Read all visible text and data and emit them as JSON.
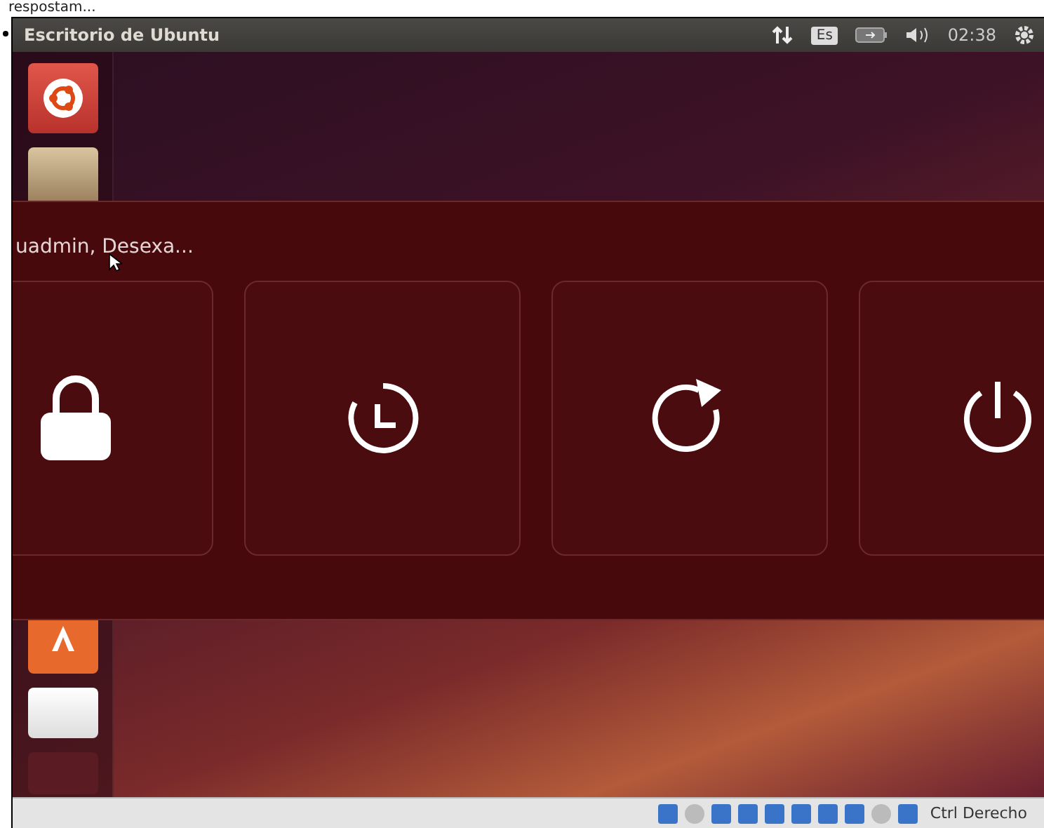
{
  "page": {
    "caption": "respostam..."
  },
  "top_panel": {
    "title": "Escritorio de Ubuntu",
    "keyboard_layout": "Es",
    "clock": "02:38"
  },
  "dialog": {
    "message": "uadmin, Desexa...",
    "actions": [
      {
        "kind": "lock"
      },
      {
        "kind": "suspend"
      },
      {
        "kind": "restart"
      },
      {
        "kind": "shutdown"
      }
    ]
  },
  "status_bar": {
    "host_key": "Ctrl Derecho"
  }
}
